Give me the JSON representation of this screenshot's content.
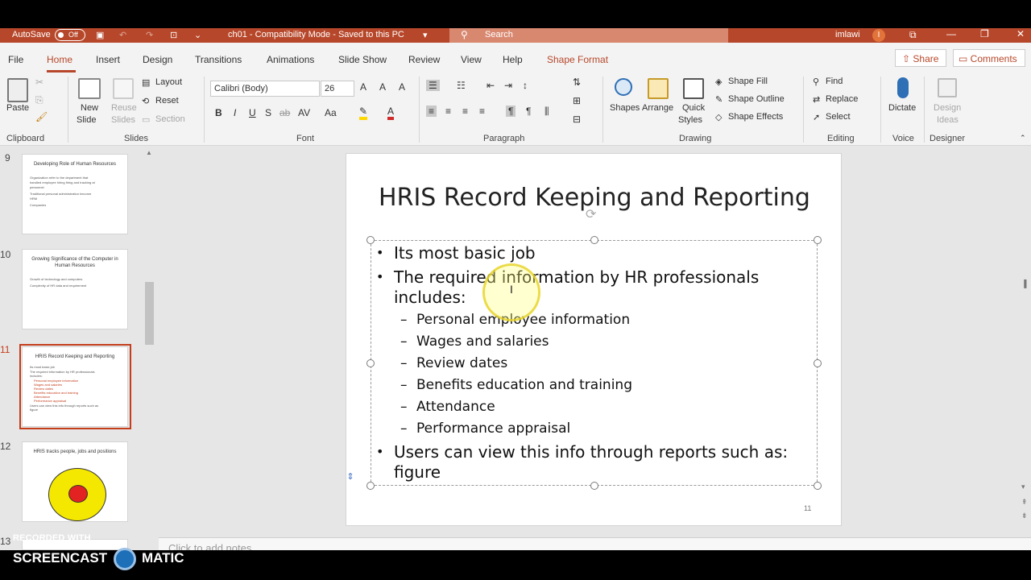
{
  "titlebar": {
    "autosave_label": "AutoSave",
    "autosave_state": "Off",
    "document_title": "ch01 - Compatibility Mode - Saved to this PC",
    "search_placeholder": "Search",
    "user_name": "imlawi",
    "avatar_initial": "I"
  },
  "menu": {
    "tabs": [
      "File",
      "Home",
      "Insert",
      "Design",
      "Transitions",
      "Animations",
      "Slide Show",
      "Review",
      "View",
      "Help",
      "Shape Format"
    ],
    "share": "Share",
    "comments": "Comments"
  },
  "ribbon": {
    "clipboard": {
      "label": "Clipboard",
      "paste": "Paste"
    },
    "slides": {
      "label": "Slides",
      "new_slide_1": "New",
      "new_slide_2": "Slide",
      "reuse_1": "Reuse",
      "reuse_2": "Slides",
      "layout": "Layout",
      "reset": "Reset",
      "section": "Section"
    },
    "font": {
      "label": "Font",
      "family": "Calibri (Body)",
      "size": "26"
    },
    "paragraph": {
      "label": "Paragraph"
    },
    "drawing": {
      "label": "Drawing",
      "shapes": "Shapes",
      "arrange": "Arrange",
      "quick_1": "Quick",
      "quick_2": "Styles",
      "fill": "Shape Fill",
      "outline": "Shape Outline",
      "effects": "Shape Effects"
    },
    "editing": {
      "label": "Editing",
      "find": "Find",
      "replace": "Replace",
      "select": "Select"
    },
    "voice": {
      "label": "Voice",
      "dictate": "Dictate"
    },
    "designer": {
      "label": "Designer",
      "ideas_1": "Design",
      "ideas_2": "Ideas"
    }
  },
  "thumbnails": [
    {
      "num": "9",
      "title": "Developing Role of Human Resources",
      "lines": [
        "Organization refer to the department that",
        "handled employee hiring firing and tracking at",
        "personnel",
        "Traditional personal administration become",
        "HRM",
        "Companies"
      ]
    },
    {
      "num": "10",
      "title": "Growing Significance of the Computer in Human Resources",
      "lines": [
        "Growth of technology and computers",
        "Complexity of HR data and requirement"
      ]
    },
    {
      "num": "11",
      "title": "HRIS Record Keeping and Reporting",
      "lines": [
        "Its most basic job",
        "The required information by HR professionals",
        "includes:",
        "Personal employee information",
        "Wages and salaries",
        "Review dates",
        "Benefits education and training",
        "Attendance",
        "Performance appraisal",
        "Users can view this info through reports such as",
        "figure"
      ]
    },
    {
      "num": "12",
      "title": "HRIS tracks people, jobs and positions",
      "lines": []
    },
    {
      "num": "13",
      "title": "",
      "lines": []
    }
  ],
  "slide": {
    "title": "HRIS Record Keeping and Reporting",
    "bullets": [
      "Its most basic job",
      "The required information by HR professionals",
      "includes:"
    ],
    "sub_bullets": [
      "Personal employee information",
      "Wages and salaries",
      "Review dates",
      "Benefits education and training",
      "Attendance",
      "Performance appraisal"
    ],
    "last_bullet_1": "Users can view this info through reports such as:",
    "last_bullet_2": "figure",
    "page_number": "11"
  },
  "notes": {
    "placeholder": "Click to add notes"
  },
  "watermark": {
    "recorded": "RECORDED WITH",
    "left": "SCREENCAST",
    "right": "MATIC"
  },
  "colors": {
    "accent": "#b7472a",
    "selection": "#c43e1c"
  }
}
